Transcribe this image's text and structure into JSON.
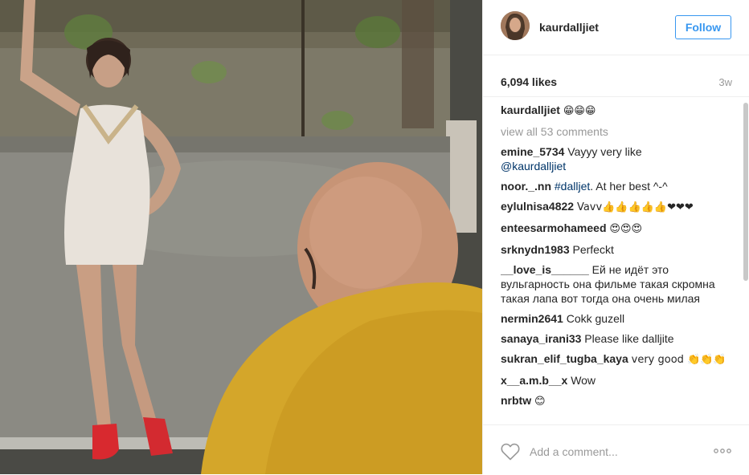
{
  "post": {
    "username": "kaurdalljiet",
    "follow_label": "Follow",
    "likes": "6,094 likes",
    "time": "3w",
    "caption_user": "kaurdalljiet",
    "caption_text": "😁😁😁",
    "view_all": "view all 53 comments",
    "comments": [
      {
        "user": "emine_5734",
        "text": "Vayyy very like",
        "mention": "@kaurdalljiet"
      },
      {
        "user": "noor._.nn",
        "mention": "#dalljet",
        "text": ". At her best ^-^"
      },
      {
        "user": "eylulnisa4822",
        "text": "Vavv👍👍👍👍👍❤❤❤"
      },
      {
        "user": "enteesarmohameed",
        "text": "😍😍😍"
      },
      {
        "user": "srknydn1983",
        "text": "Perfeckt"
      },
      {
        "user": "__love_is______",
        "text": "Ей не идёт это вульгарность она фильме такая скромна такая лапа вот тогда она очень милая"
      },
      {
        "user": "nermin2641",
        "text": "Cokk guzell"
      },
      {
        "user": "sanaya_irani33",
        "text": "Please like dalljite"
      },
      {
        "user": "sukran_elif_tugba_kaya",
        "text": "very good 👏👏👏"
      },
      {
        "user": "x__a.m.b__x",
        "text": "Wow"
      },
      {
        "user": "nrbtw",
        "text": "😊"
      }
    ],
    "add_comment_placeholder": "Add a comment...",
    "icons": {
      "heart": "heart-icon",
      "more": "more-options-icon"
    },
    "colors": {
      "accent": "#3897f0",
      "mention": "#003569",
      "muted": "#999999"
    }
  }
}
